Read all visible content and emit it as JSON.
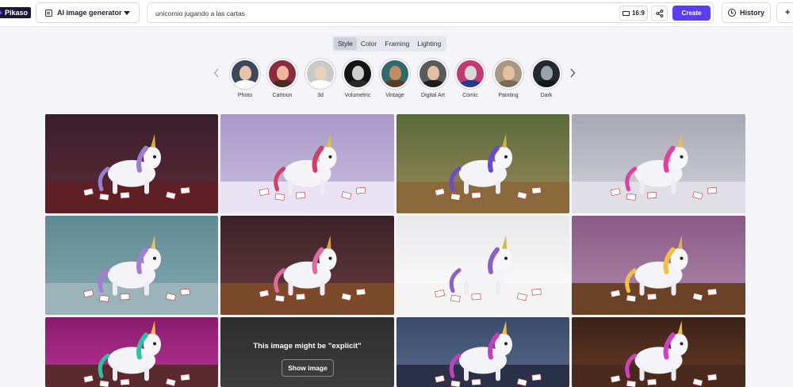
{
  "app": {
    "logo_text": "Pikaso"
  },
  "header": {
    "mode_label": "AI image generator",
    "prompt_value": "unicornio jugando a las cartas",
    "ratio_label": "16:9",
    "create_label": "Create",
    "history_label": "History",
    "plus_label": "+"
  },
  "tabs": [
    "Style",
    "Color",
    "Framing",
    "Lighting"
  ],
  "active_tab": "Style",
  "styles": [
    {
      "label": "Photo",
      "bg": "#3a4a5c",
      "face": "#e8c4a8",
      "body": "#ffffff"
    },
    {
      "label": "Cartoon",
      "bg": "#8a2c3c",
      "face": "#f0b89a",
      "body": "#4a2a22"
    },
    {
      "label": "3d",
      "bg": "#c9c9c9",
      "face": "#e8d2b8",
      "body": "#ffffff"
    },
    {
      "label": "Volumetric",
      "bg": "#141414",
      "face": "#cfcfcf",
      "body": "#2a2a2a"
    },
    {
      "label": "Vintage",
      "bg": "#2f6b6a",
      "face": "#c48a62",
      "body": "#5a3c24"
    },
    {
      "label": "Digital Art",
      "bg": "#5a5a5a",
      "face": "#e2c0a4",
      "body": "#1e1e1e"
    },
    {
      "label": "Comic",
      "bg": "#c23a72",
      "face": "#d9d9d9",
      "body": "#2a3a8a"
    },
    {
      "label": "Painting",
      "bg": "#a89a82",
      "face": "#e4c0a0",
      "body": "#7a6a54"
    },
    {
      "label": "Dark",
      "bg": "#24292f",
      "face": "#9aa2aa",
      "body": "#15191d"
    }
  ],
  "gallery": {
    "explicit_notice": "This image might be \"explicit\"",
    "show_image_label": "Show image",
    "tiles": [
      {
        "bg1": "#3a1f2c",
        "bg2": "#5c2a36",
        "floor": "#5e1f25",
        "mane": "#9a7fd0",
        "horn": "#d9b040"
      },
      {
        "bg1": "#a89ac8",
        "bg2": "#cbbfe0",
        "floor": "#e8e2f2",
        "mane": "#d04060",
        "horn": "#e8c040"
      },
      {
        "bg1": "#5a6a3a",
        "bg2": "#9a8a5a",
        "floor": "#8a6a3a",
        "mane": "#6a4ad0",
        "horn": "#d0b050"
      },
      {
        "bg1": "#a8a8b4",
        "bg2": "#d4d4dc",
        "floor": "#e0dfe6",
        "mane": "#e040a0",
        "horn": "#e8c040"
      },
      {
        "bg1": "#5f8a94",
        "bg2": "#86a8b0",
        "floor": "#9ab4ba",
        "mane": "#a87ad8",
        "horn": "#e8c060"
      },
      {
        "bg1": "#3a2228",
        "bg2": "#6a3c40",
        "floor": "#7a4a2a",
        "mane": "#e06aa0",
        "horn": "#d8a040"
      },
      {
        "bg1": "#e8e8ea",
        "bg2": "#ffffff",
        "floor": "#f4f4f4",
        "mane": "#8a60d0",
        "horn": "#e0b040"
      },
      {
        "bg1": "#8a5a86",
        "bg2": "#b08aac",
        "floor": "#6a4226",
        "mane": "#f0c040",
        "horn": "#e0b050"
      },
      {
        "bg1": "#8a1c6c",
        "bg2": "#b8329a",
        "floor": "#5a2a30",
        "mane": "#30c0a0",
        "horn": "#f0c040"
      },
      {
        "explicit": true
      },
      {
        "bg1": "#3a4a6a",
        "bg2": "#5a6a8a",
        "floor": "#2a3048",
        "mane": "#c040c0",
        "horn": "#e8c040"
      },
      {
        "bg1": "#3a2218",
        "bg2": "#6a3c24",
        "floor": "#4a2a1c",
        "mane": "#d040c0",
        "horn": "#e8c040"
      }
    ]
  }
}
